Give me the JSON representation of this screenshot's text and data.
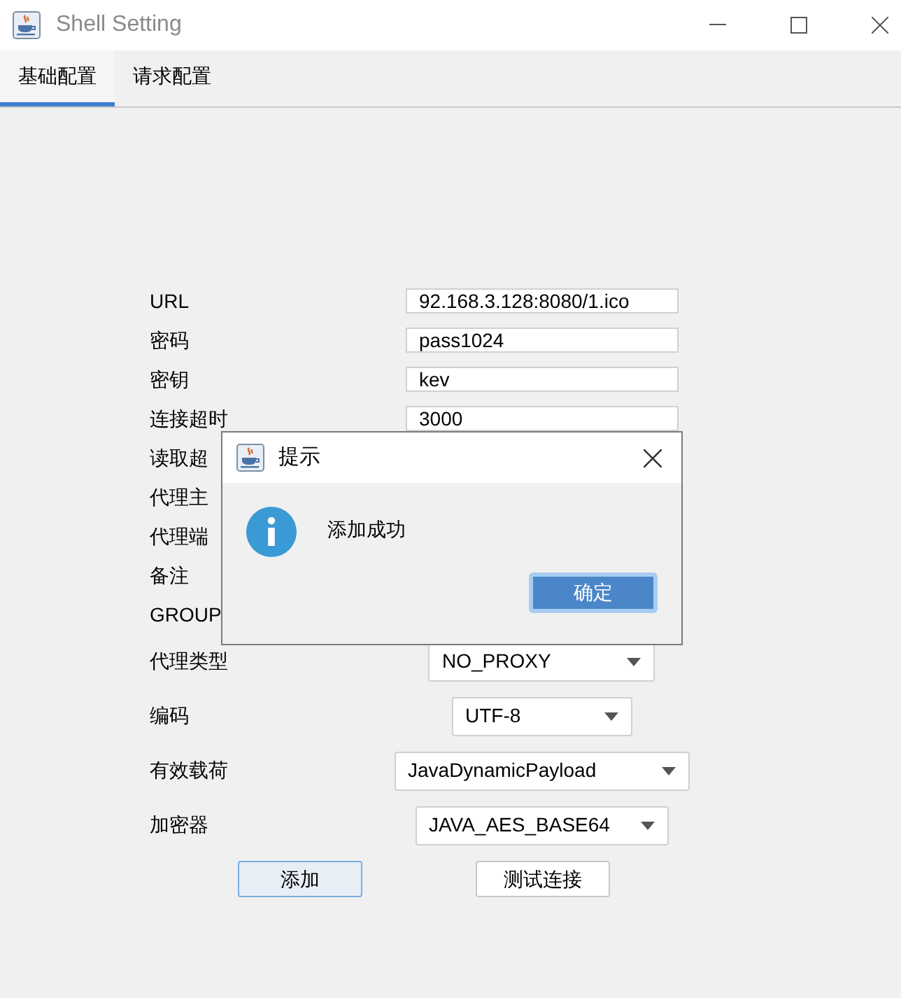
{
  "window": {
    "title": "Shell Setting"
  },
  "tabs": [
    {
      "label": "基础配置",
      "selected": true
    },
    {
      "label": "请求配置",
      "selected": false
    }
  ],
  "form": {
    "rows": [
      {
        "label": "URL",
        "kind": "text",
        "value": "92.168.3.128:8080/1.ico"
      },
      {
        "label": "密码",
        "kind": "text",
        "value": "pass1024"
      },
      {
        "label": "密钥",
        "kind": "text",
        "value": "kev"
      },
      {
        "label": "连接超时",
        "kind": "text",
        "value": "3000"
      },
      {
        "label": "读取超",
        "kind": "covered"
      },
      {
        "label": "代理主",
        "kind": "covered"
      },
      {
        "label": "代理端",
        "kind": "covered"
      },
      {
        "label": "备注",
        "kind": "covered"
      },
      {
        "label": "GROUP",
        "kind": "covered"
      }
    ],
    "selects": [
      {
        "label": "代理类型",
        "value": "NO_PROXY"
      },
      {
        "label": "编码",
        "value": "UTF-8"
      },
      {
        "label": "有效载荷",
        "value": "JavaDynamicPayload"
      },
      {
        "label": "加密器",
        "value": "JAVA_AES_BASE64"
      }
    ],
    "buttons": [
      {
        "label": "添加",
        "focused": true
      },
      {
        "label": "测试连接",
        "focused": false
      }
    ]
  },
  "dialog": {
    "title": "提示",
    "message": "添加成功",
    "button": {
      "label": "确定",
      "focused": true
    }
  }
}
